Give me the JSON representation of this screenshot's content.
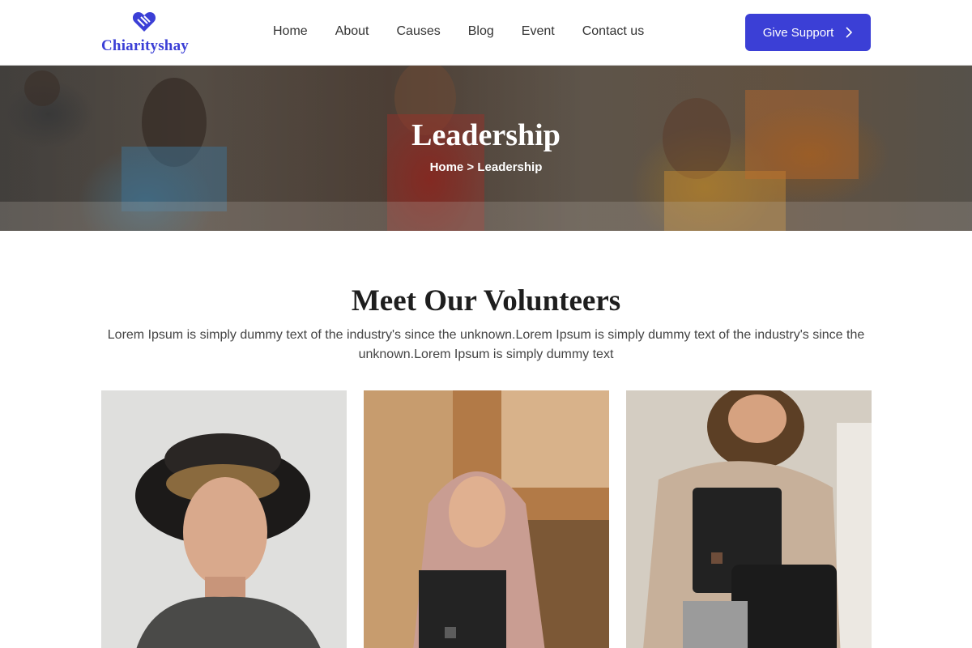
{
  "brand": {
    "name": "Chiarityshay",
    "logo_icon": "heart-hands-icon",
    "accent_color": "#3b3fd6"
  },
  "nav": {
    "items": [
      "Home",
      "About",
      "Causes",
      "Blog",
      "Event",
      "Contact us"
    ]
  },
  "header": {
    "cta_label": "Give Support",
    "cta_icon": "chevron-right-icon"
  },
  "hero": {
    "title": "Leadership",
    "breadcrumb": "Home > Leadership"
  },
  "volunteers": {
    "title": "Meet Our Volunteers",
    "description": "Lorem Ipsum is simply dummy text of the industry's since the unknown.Lorem Ipsum is simply dummy text of the industry's since the unknown.Lorem Ipsum is simply dummy text"
  }
}
